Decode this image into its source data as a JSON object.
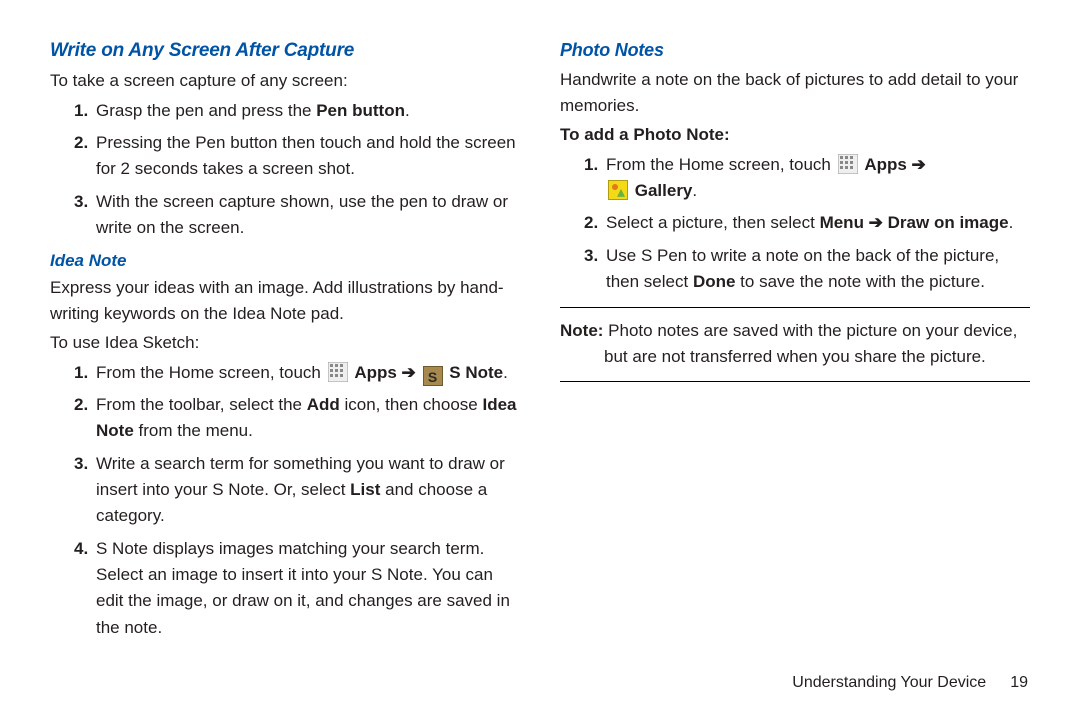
{
  "left": {
    "section1_heading": "Write on Any Screen After Capture",
    "section1_intro": "To take a screen capture of any screen:",
    "section1_steps": {
      "s1_pre": "Grasp the pen and press the ",
      "s1_bold": "Pen button",
      "s1_post": ".",
      "s2": "Pressing the Pen button then touch and hold the screen for 2 seconds takes a screen shot.",
      "s3": "With the screen capture shown, use the pen to draw or write on the screen."
    },
    "section2_heading": "Idea Note",
    "section2_p1": "Express your ideas with an image. Add illustrations by hand-writing keywords on the Idea Note pad.",
    "section2_leadin": "To use Idea Sketch:",
    "section2_steps": {
      "s1_pre": "From the Home screen, touch ",
      "s1_apps": "Apps",
      "s1_arrow": " ➔ ",
      "s1_snote": "S Note",
      "s1_post": ".",
      "s2_pre": "From the toolbar, select the ",
      "s2_b1": "Add",
      "s2_mid": " icon, then choose ",
      "s2_b2": "Idea Note",
      "s2_post": " from the menu.",
      "s3_pre": "Write a search term for something you want to draw or insert into your S Note. Or, select ",
      "s3_b": "List",
      "s3_post": " and choose a category.",
      "s4": "S Note displays images matching your search term. Select an image to insert it into your S Note. You can edit the image, or draw on it, and changes are saved in the note."
    }
  },
  "right": {
    "section1_heading": "Photo Notes",
    "section1_p1": "Handwrite a note on the back of pictures to add detail to your memories.",
    "section1_leadin": "To add a Photo Note:",
    "section1_steps": {
      "s1_pre": "From the Home screen, touch ",
      "s1_apps": "Apps",
      "s1_arrow": " ➔",
      "s1_gallery": "Gallery",
      "s1_post": ".",
      "s2_pre": "Select a picture, then select ",
      "s2_b1": "Menu",
      "s2_arrow": " ➔ ",
      "s2_b2": "Draw on image",
      "s2_post": ".",
      "s3_pre": "Use S Pen to write a note on the back of the picture, then select ",
      "s3_b": "Done",
      "s3_post": " to save the note with the picture."
    },
    "note_label": "Note:",
    "note_text": " Photo notes are saved with the picture on your device, but are not transferred when you share the picture."
  },
  "footer": {
    "chapter": "Understanding Your Device",
    "page": "19"
  }
}
